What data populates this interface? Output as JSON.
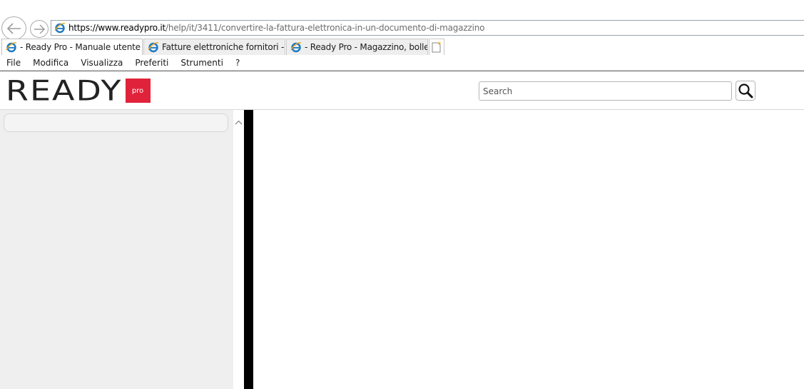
{
  "browser": {
    "url": {
      "scheme": "https://www.",
      "domain": "readypro.it",
      "path": "/help/it/3411/convertire-la-fattura-elettronica-in-un-documento-di-magazzino"
    },
    "tabs": [
      {
        "label": "- Ready Pro - Manuale utente",
        "close": "×",
        "active": true
      },
      {
        "label": "Fatture elettroniche fornitori - ...",
        "active": false
      },
      {
        "label": "- Ready Pro - Magazzino, bolle...",
        "active": false
      }
    ],
    "menu": [
      "File",
      "Modifica",
      "Visualizza",
      "Preferiti",
      "Strumenti",
      "?"
    ]
  },
  "site": {
    "logo_text": "READY",
    "logo_badge": "pro",
    "search": {
      "placeholder": "Search",
      "value": ""
    }
  },
  "colors": {
    "brand_red": "#e0233a",
    "ie_blue": "#1d79c5",
    "divider": "#000000",
    "panel_bg": "#efefef"
  },
  "icons": {
    "back": "back-arrow-icon",
    "forward": "forward-arrow-icon",
    "page": "ie-page-icon",
    "new_tab": "new-tab-icon",
    "search": "magnifier-icon",
    "scroll_up": "chevron-up-icon"
  }
}
